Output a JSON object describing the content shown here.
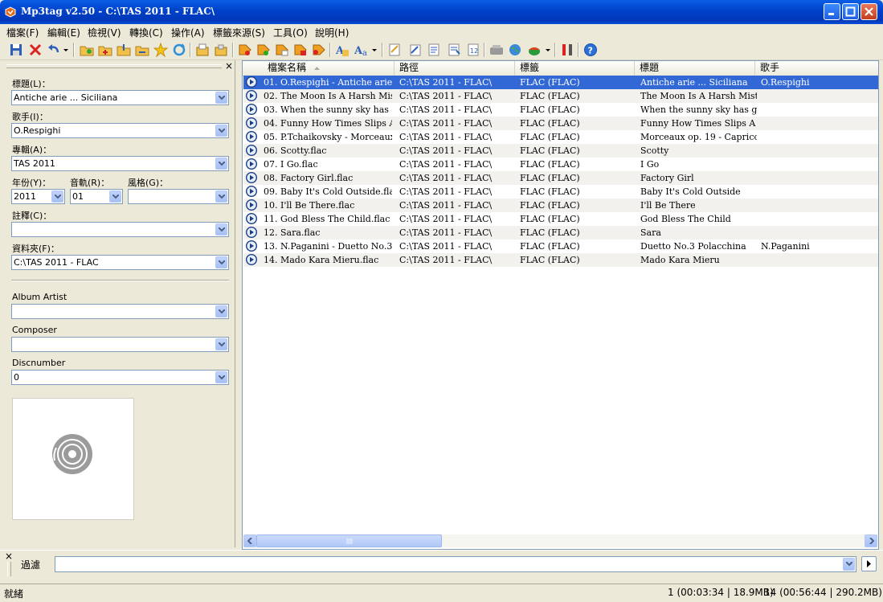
{
  "window": {
    "title": "Mp3tag v2.50  -  C:\\TAS 2011 - FLAC\\"
  },
  "menu": [
    "檔案(F)",
    "編輯(E)",
    "檢視(V)",
    "轉換(C)",
    "操作(A)",
    "標籤來源(S)",
    "工具(O)",
    "說明(H)"
  ],
  "toolbar": {
    "icons": [
      "save-icon",
      "remove-tag-icon",
      "undo-icon",
      "change-directory-icon",
      "add-directory-icon",
      "import-icon",
      "export-icon",
      "favorite-icon",
      "refresh-icon",
      "copy-tag-icon",
      "paste-tag-icon",
      "tag-filename-icon",
      "filename-tag-icon",
      "text-tag-icon",
      "tag-tag-icon",
      "case-convert-icon",
      "actions-icon",
      "extended-tags-icon",
      "playlist-icon",
      "autonumber-icon",
      "freedb-icon",
      "web-sources-icon",
      "discogs-icon",
      "tools-icon",
      "help-icon"
    ]
  },
  "panel": {
    "close": "×",
    "title_label": "標題(L)：",
    "title_value": "Antiche arie ... Siciliana",
    "artist_label": "歌手(I)：",
    "artist_value": "O.Respighi",
    "album_label": "專輯(A)：",
    "album_value": "TAS 2011",
    "year_label": "年份(Y)：",
    "year_value": "2011",
    "track_label": "音軌(R)：",
    "track_value": "01",
    "genre_label": "風格(G)：",
    "genre_value": "",
    "comment_label": "註釋(C)：",
    "comment_value": "",
    "folder_label": "資料夾(F)：",
    "folder_value": "C:\\TAS 2011 - FLAC",
    "album_artist_label": "Album Artist",
    "album_artist_value": "",
    "composer_label": "Composer",
    "composer_value": "",
    "discnumber_label": "Discnumber",
    "discnumber_value": "0"
  },
  "list": {
    "columns": [
      "檔案名稱",
      "路徑",
      "標籤",
      "標題",
      "歌手"
    ],
    "rows": [
      {
        "file": "01. O.Respighi - Antiche arie ......",
        "path": "C:\\TAS 2011 - FLAC\\",
        "tag": "FLAC (FLAC)",
        "title": "Antiche arie ... Siciliana",
        "artist": "O.Respighi"
      },
      {
        "file": "02. The Moon Is A Harsh Mistr...",
        "path": "C:\\TAS 2011 - FLAC\\",
        "tag": "FLAC (FLAC)",
        "title": "The Moon Is A Harsh Mistr...",
        "artist": ""
      },
      {
        "file": "03. When the sunny sky has go...",
        "path": "C:\\TAS 2011 - FLAC\\",
        "tag": "FLAC (FLAC)",
        "title": "When the sunny sky has go...",
        "artist": ""
      },
      {
        "file": "04. Funny How Times Slips Aw...",
        "path": "C:\\TAS 2011 - FLAC\\",
        "tag": "FLAC (FLAC)",
        "title": "Funny How Times Slips A ...",
        "artist": ""
      },
      {
        "file": "05. P.Tchaikovsky - Morceaux ...",
        "path": "C:\\TAS 2011 - FLAC\\",
        "tag": "FLAC (FLAC)",
        "title": "Morceaux op. 19 - Capricci...",
        "artist": ""
      },
      {
        "file": "06. Scotty.flac",
        "path": "C:\\TAS 2011 - FLAC\\",
        "tag": "FLAC (FLAC)",
        "title": "Scotty",
        "artist": ""
      },
      {
        "file": "07. I Go.flac",
        "path": "C:\\TAS 2011 - FLAC\\",
        "tag": "FLAC (FLAC)",
        "title": "I Go",
        "artist": ""
      },
      {
        "file": "08. Factory Girl.flac",
        "path": "C:\\TAS 2011 - FLAC\\",
        "tag": "FLAC (FLAC)",
        "title": "Factory Girl",
        "artist": ""
      },
      {
        "file": "09. Baby It's Cold Outside.flac",
        "path": "C:\\TAS 2011 - FLAC\\",
        "tag": "FLAC (FLAC)",
        "title": "Baby It's Cold Outside",
        "artist": ""
      },
      {
        "file": "10. I'll Be There.flac",
        "path": "C:\\TAS 2011 - FLAC\\",
        "tag": "FLAC (FLAC)",
        "title": "I'll Be There",
        "artist": ""
      },
      {
        "file": "11. God Bless The Child.flac",
        "path": "C:\\TAS 2011 - FLAC\\",
        "tag": "FLAC (FLAC)",
        "title": "God Bless The Child",
        "artist": ""
      },
      {
        "file": "12. Sara.flac",
        "path": "C:\\TAS 2011 - FLAC\\",
        "tag": "FLAC (FLAC)",
        "title": "Sara",
        "artist": ""
      },
      {
        "file": "13. N.Paganini - Duetto No.3  P...",
        "path": "C:\\TAS 2011 - FLAC\\",
        "tag": "FLAC (FLAC)",
        "title": "Duetto No.3  Polacchina",
        "artist": "N.Paganini"
      },
      {
        "file": "14. Mado Kara Mieru.flac",
        "path": "C:\\TAS 2011 - FLAC\\",
        "tag": "FLAC (FLAC)",
        "title": "Mado Kara Mieru",
        "artist": ""
      }
    ],
    "selected_index": 0
  },
  "filter": {
    "close": "×",
    "label": "過濾",
    "value": ""
  },
  "status": {
    "left": "就緒",
    "selection": "1 (00:03:34 | 18.9MB)",
    "total": "14 (00:56:44 | 290.2MB)"
  },
  "colors": {
    "titlebar": "#0041c8",
    "selection": "#3168d5",
    "face": "#ece9d8"
  }
}
